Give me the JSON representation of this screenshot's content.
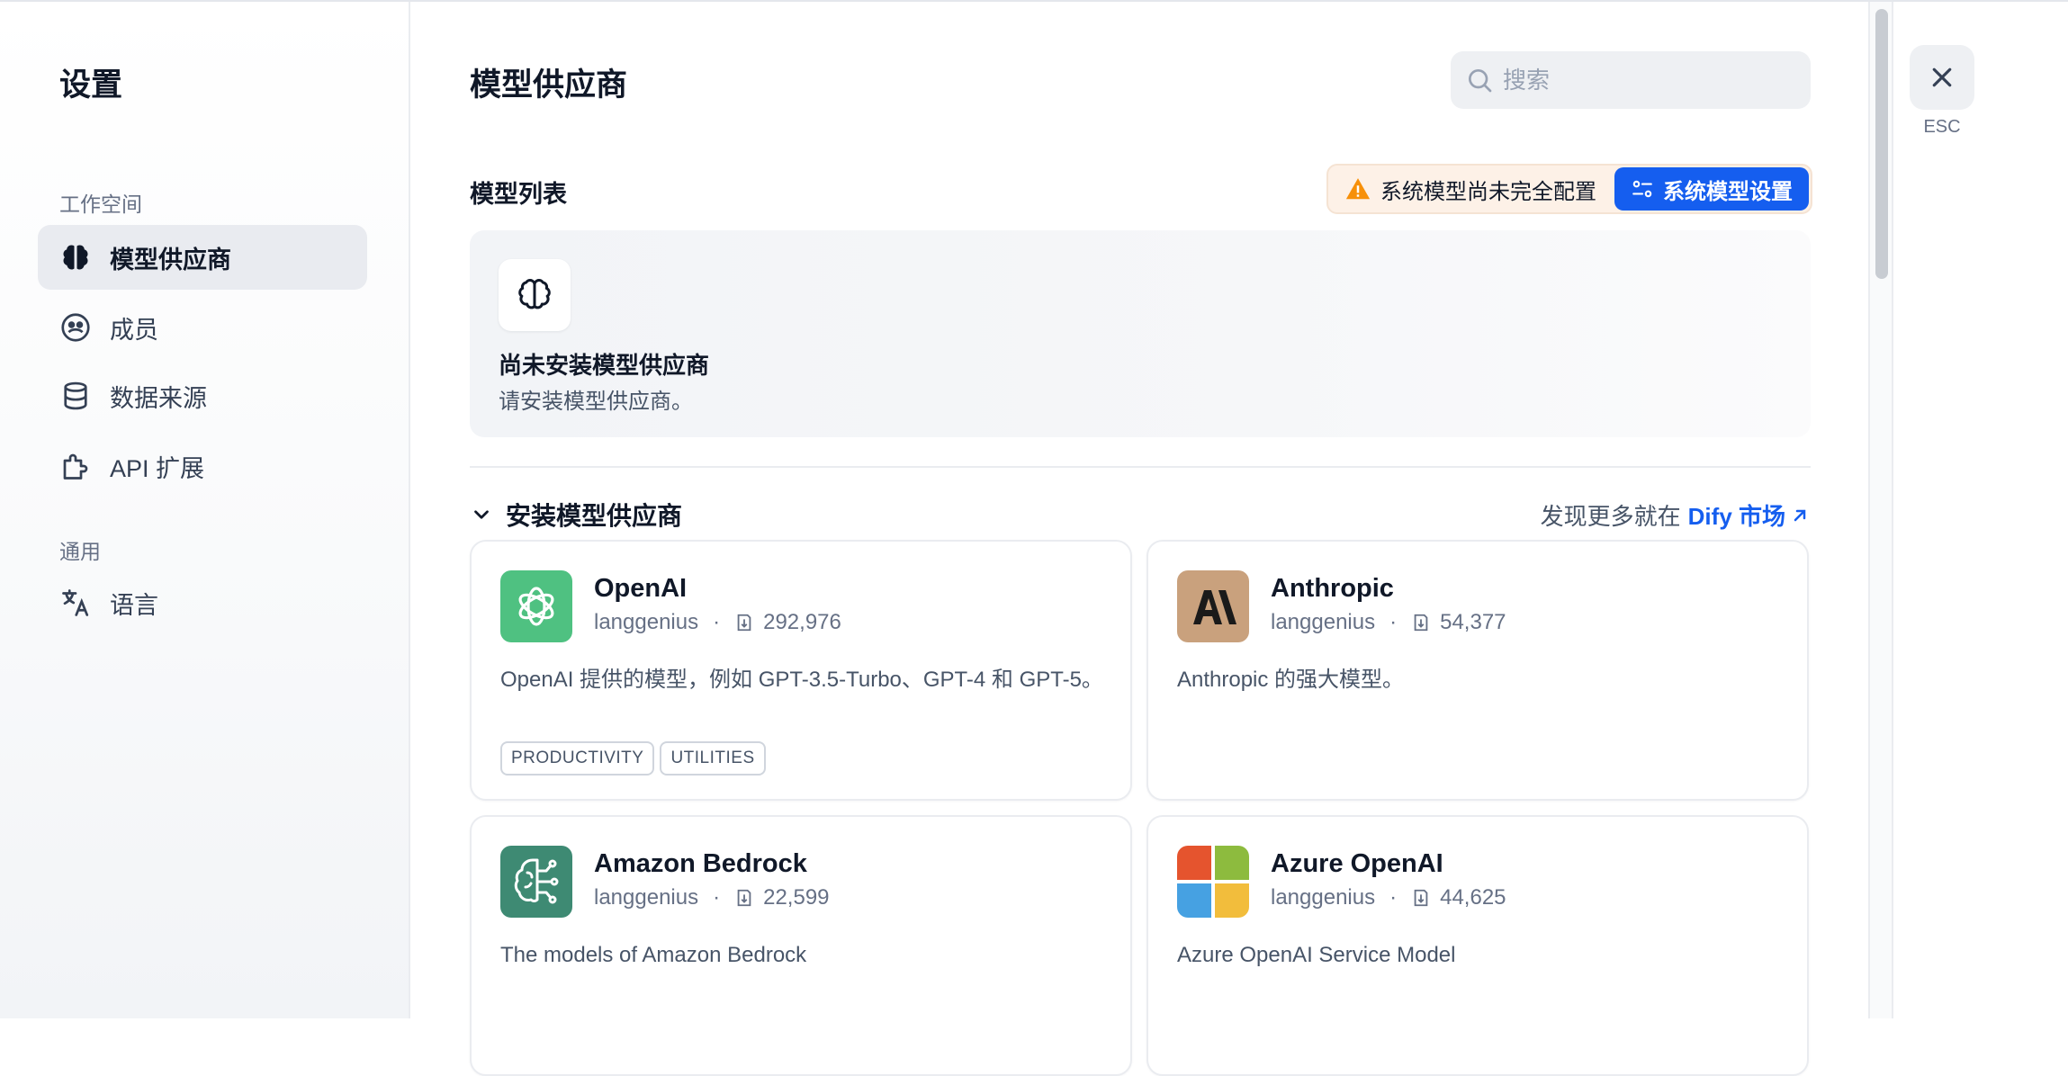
{
  "sidebar": {
    "title": "设置",
    "workspace_section": "工作空间",
    "general_section": "通用",
    "items": [
      {
        "label": "模型供应商",
        "icon": "brain-icon",
        "active": true
      },
      {
        "label": "成员",
        "icon": "members-icon",
        "active": false
      },
      {
        "label": "数据来源",
        "icon": "database-icon",
        "active": false
      },
      {
        "label": "API 扩展",
        "icon": "puzzle-icon",
        "active": false
      }
    ],
    "general_items": [
      {
        "label": "语言",
        "icon": "translate-icon"
      }
    ]
  },
  "main": {
    "title": "模型供应商",
    "search_placeholder": "搜索",
    "list_title": "模型列表",
    "warning_text": "系统模型尚未完全配置",
    "system_settings_button": "系统模型设置",
    "empty_state": {
      "title": "尚未安装模型供应商",
      "description": "请安装模型供应商。"
    },
    "install_header": "安装模型供应商",
    "discover_prefix": "发现更多就在",
    "discover_link": "Dify 市场",
    "providers": [
      {
        "name": "OpenAI",
        "author": "langgenius",
        "installs": "292,976",
        "description": "OpenAI 提供的模型，例如 GPT-3.5-Turbo、GPT-4 和 GPT-5。",
        "tags": [
          "PRODUCTIVITY",
          "UTILITIES"
        ],
        "logo": "openai-logo-icon",
        "color": "#4fc181"
      },
      {
        "name": "Anthropic",
        "author": "langgenius",
        "installs": "54,377",
        "description": "Anthropic 的强大模型。",
        "tags": [],
        "logo": "anthropic-logo-icon",
        "color": "#c9a17d"
      },
      {
        "name": "Amazon Bedrock",
        "author": "langgenius",
        "installs": "22,599",
        "description": "The models of Amazon Bedrock",
        "tags": [],
        "logo": "bedrock-logo-icon",
        "color": "#3e8a73"
      },
      {
        "name": "Azure OpenAI",
        "author": "langgenius",
        "installs": "44,625",
        "description": "Azure OpenAI Service Model",
        "tags": [],
        "logo": "microsoft-logo-icon",
        "color": "#e5542e"
      }
    ],
    "meta_separator": "·"
  },
  "close": {
    "esc_label": "ESC"
  },
  "colors": {
    "accent": "#155eef",
    "warning": "#f79009"
  }
}
